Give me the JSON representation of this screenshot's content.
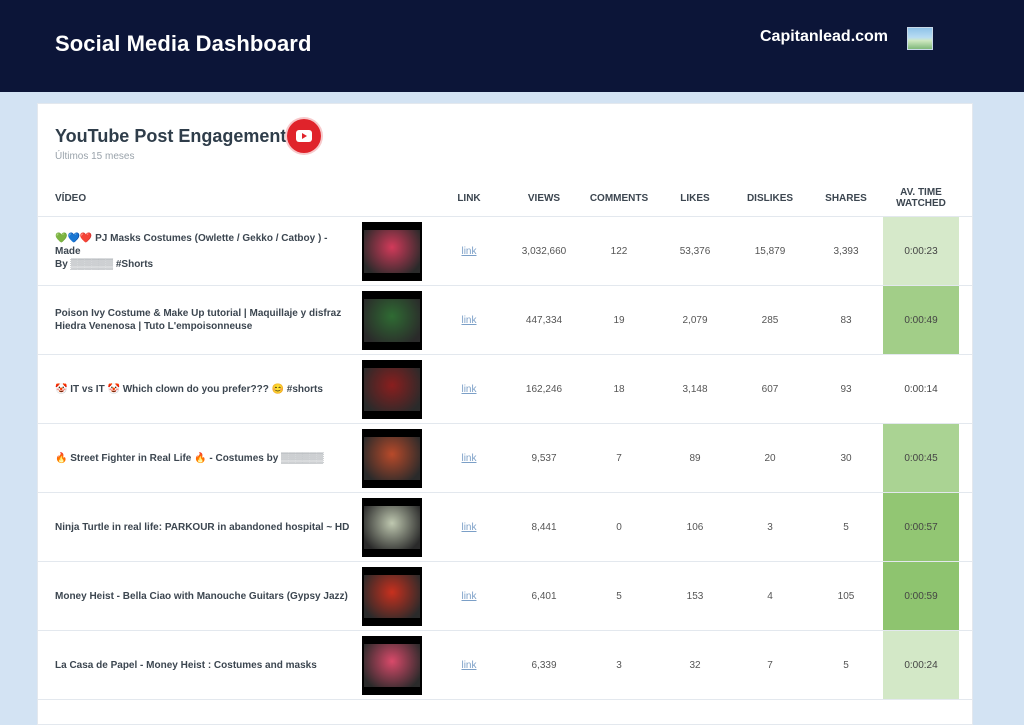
{
  "header": {
    "title": "Social Media Dashboard",
    "brand": "Capitanlead.com"
  },
  "card": {
    "title": "YouTube Post Engagement",
    "subtitle": "Últimos 15 meses"
  },
  "columns": {
    "video": "VÍDEO",
    "link": "LINK",
    "views": "VIEWS",
    "comments": "COMMENTS",
    "likes": "LIKES",
    "dislikes": "DISLIKES",
    "shares": "SHARES",
    "avtime_1": "AV. TIME",
    "avtime_2": "WATCHED"
  },
  "rows": [
    {
      "title_1": "💚💙❤️ PJ Masks Costumes (Owlette / Gekko / Catboy ) - Made",
      "title_2": "By ▒▒▒▒▒▒ #Shorts",
      "link": "link",
      "views": "3,032,660",
      "comments": "122",
      "likes": "53,376",
      "dislikes": "15,879",
      "shares": "3,393",
      "time": "0:00:23",
      "time_fraction": 0.39,
      "thumb_color": "#d23a5a"
    },
    {
      "title_1": "Poison Ivy Costume & Make Up tutorial | Maquillaje y disfraz",
      "title_2": "Hiedra Venenosa | Tuto L'empoisonneuse",
      "link": "link",
      "views": "447,334",
      "comments": "19",
      "likes": "2,079",
      "dislikes": "285",
      "shares": "83",
      "time": "0:00:49",
      "time_fraction": 0.83,
      "thumb_color": "#2f6b33"
    },
    {
      "title_1": "🤡 IT vs IT 🤡 Which clown do you prefer??? 😊 #shorts",
      "title_2": "",
      "link": "link",
      "views": "162,246",
      "comments": "18",
      "likes": "3,148",
      "dislikes": "607",
      "shares": "93",
      "time": "0:00:14",
      "time_fraction": 0.24,
      "thumb_color": "#8a1e1e"
    },
    {
      "title_1": "🔥 Street Fighter in Real Life 🔥 - Costumes by ▒▒▒▒▒▒",
      "title_2": "",
      "link": "link",
      "views": "9,537",
      "comments": "7",
      "likes": "89",
      "dislikes": "20",
      "shares": "30",
      "time": "0:00:45",
      "time_fraction": 0.76,
      "thumb_color": "#b84a2a"
    },
    {
      "title_1": "Ninja Turtle in real life: PARKOUR in abandoned hospital ~ HD",
      "title_2": "",
      "link": "link",
      "views": "8,441",
      "comments": "0",
      "likes": "106",
      "dislikes": "3",
      "shares": "5",
      "time": "0:00:57",
      "time_fraction": 0.97,
      "thumb_color": "#bfc8b0"
    },
    {
      "title_1": "Money Heist - Bella Ciao with Manouche Guitars (Gypsy Jazz)",
      "title_2": "",
      "link": "link",
      "views": "6,401",
      "comments": "5",
      "likes": "153",
      "dislikes": "4",
      "shares": "105",
      "time": "0:00:59",
      "time_fraction": 1.0,
      "thumb_color": "#c8301e"
    },
    {
      "title_1": "La Casa de Papel - Money Heist : Costumes and masks",
      "title_2": "",
      "link": "link",
      "views": "6,339",
      "comments": "3",
      "likes": "32",
      "dislikes": "7",
      "shares": "5",
      "time": "0:00:24",
      "time_fraction": 0.41,
      "thumb_color": "#d94a6a"
    }
  ]
}
